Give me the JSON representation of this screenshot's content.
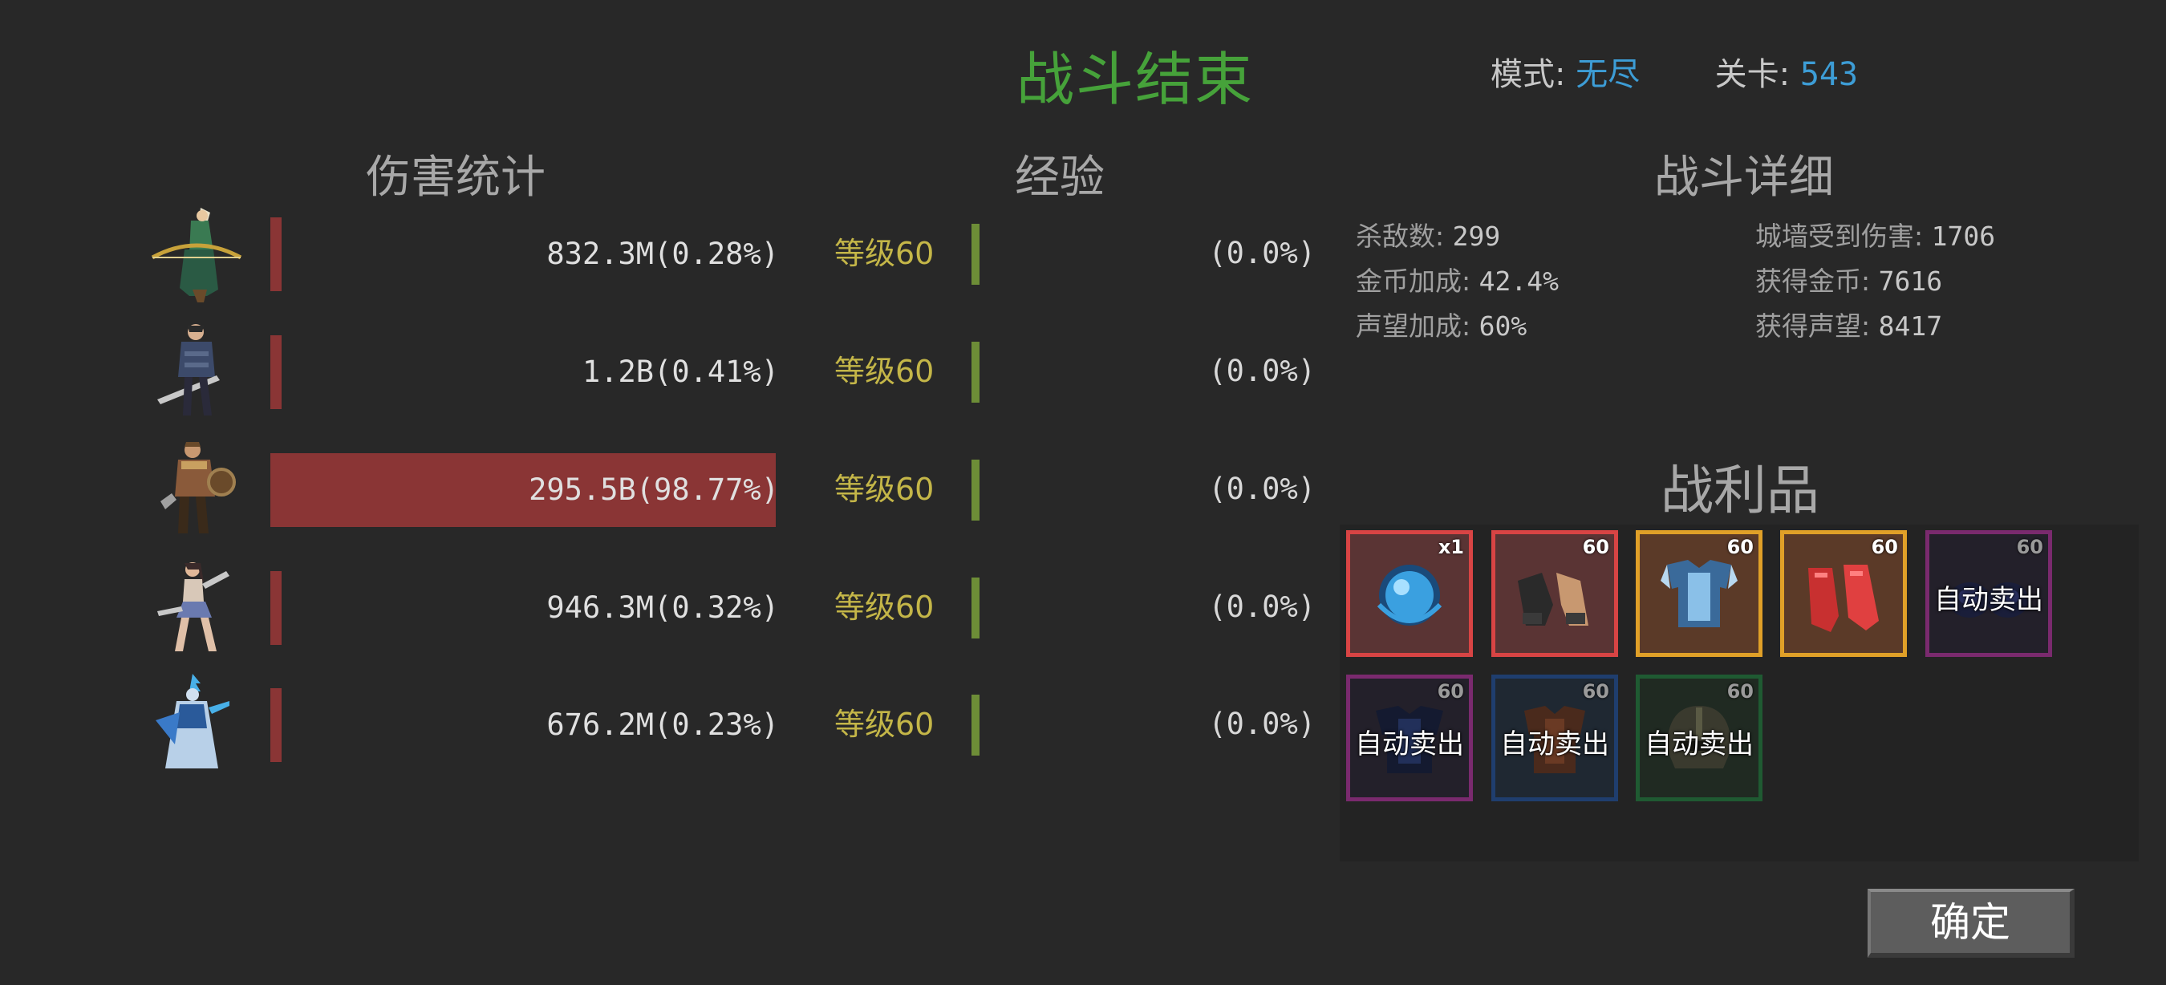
{
  "header": {
    "title": "战斗结束",
    "mode_label": "模式:",
    "mode_value": "无尽",
    "stage_label": "关卡:",
    "stage_value": "543"
  },
  "sections": {
    "damage_title": "伤害统计",
    "exp_title": "经验",
    "details_title": "战斗详细",
    "loot_title": "战利品"
  },
  "heroes": [
    {
      "portrait": "elf-archer-icon",
      "damage": "832.3M(0.28%)",
      "damage_share": 0.0028,
      "level": "等级60",
      "exp": "(0.0%)"
    },
    {
      "portrait": "swordsman-icon",
      "damage": "1.2B(0.41%)",
      "damage_share": 0.0041,
      "level": "等级60",
      "exp": "(0.0%)"
    },
    {
      "portrait": "barbarian-icon",
      "damage": "295.5B(98.77%)",
      "damage_share": 0.9877,
      "level": "等级60",
      "exp": "(0.0%)"
    },
    {
      "portrait": "dancer-icon",
      "damage": "946.3M(0.32%)",
      "damage_share": 0.0032,
      "level": "等级60",
      "exp": "(0.0%)"
    },
    {
      "portrait": "ice-sorceress-icon",
      "damage": "676.2M(0.23%)",
      "damage_share": 0.0023,
      "level": "等级60",
      "exp": "(0.0%)"
    }
  ],
  "details": {
    "kills_label": "杀敌数:",
    "kills": "299",
    "wall_damage_label": "城墙受到伤害:",
    "wall_damage": "1706",
    "gold_bonus_label": "金币加成:",
    "gold_bonus": "42.4%",
    "gold_gained_label": "获得金币:",
    "gold_gained": "7616",
    "fame_bonus_label": "声望加成:",
    "fame_bonus": "60%",
    "fame_gained_label": "获得声望:",
    "fame_gained": "8417"
  },
  "loot": [
    {
      "icon": "blue-orb-icon",
      "rarity": "red",
      "badge": "x1",
      "auto_sell": ""
    },
    {
      "icon": "gauntlets-icon",
      "rarity": "red",
      "badge": "60",
      "auto_sell": ""
    },
    {
      "icon": "chest-armor-icon",
      "rarity": "orange",
      "badge": "60",
      "auto_sell": ""
    },
    {
      "icon": "red-gloves-icon",
      "rarity": "orange",
      "badge": "60",
      "auto_sell": ""
    },
    {
      "icon": "boots-icon",
      "rarity": "purple",
      "badge": "60",
      "auto_sell": "自动卖出"
    },
    {
      "icon": "dark-armor-icon",
      "rarity": "purple",
      "badge": "60",
      "auto_sell": "自动卖出"
    },
    {
      "icon": "leather-armor-icon",
      "rarity": "blue",
      "badge": "60",
      "auto_sell": "自动卖出"
    },
    {
      "icon": "helmet-icon",
      "rarity": "green",
      "badge": "60",
      "auto_sell": "自动卖出"
    }
  ],
  "confirm_label": "确定",
  "colors": {
    "background": "#282828",
    "title_green": "#46a23a",
    "mode_blue": "#3d9dd6",
    "damage_red": "#8a3535",
    "level_yellow": "#c4b648",
    "exp_green": "#6d8d37"
  }
}
